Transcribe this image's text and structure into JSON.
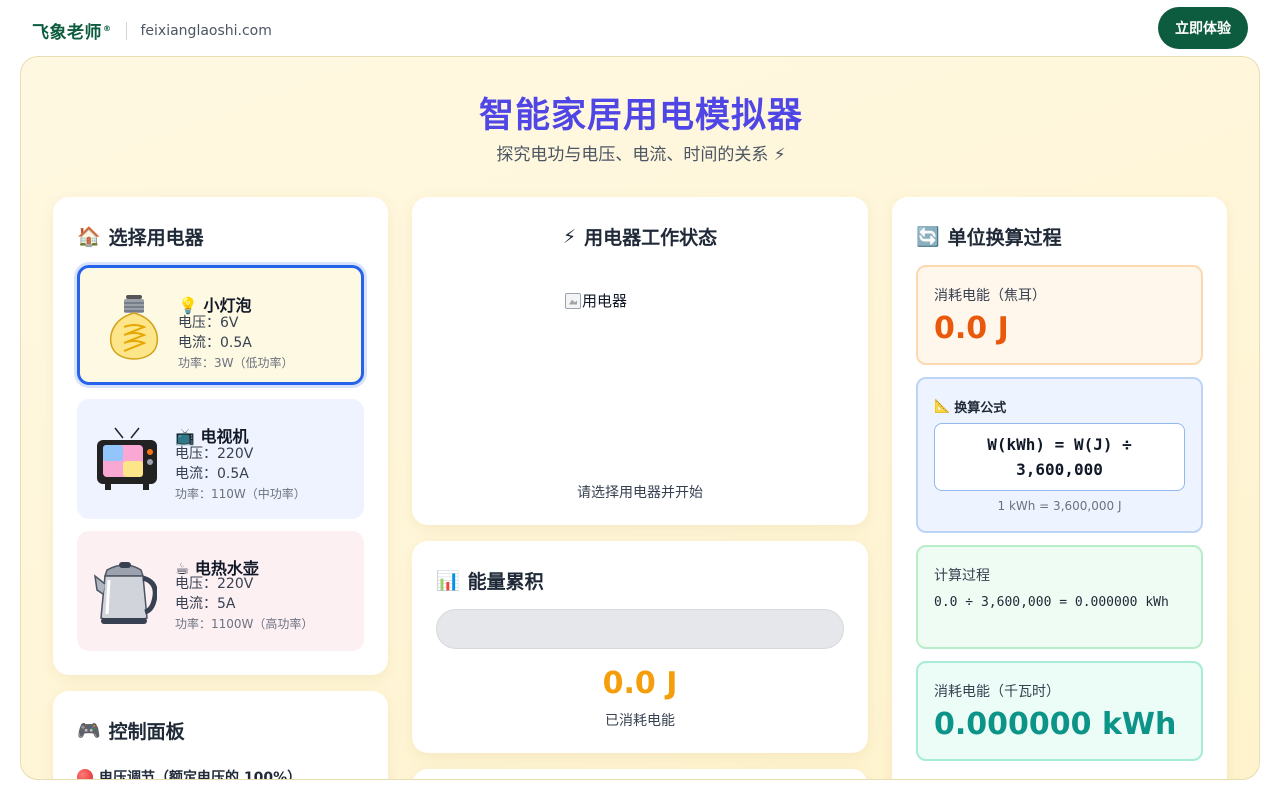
{
  "header": {
    "brand_name": "飞象老师",
    "brand_mark": "®",
    "brand_url": "feixianglaoshi.com",
    "cta_label": "立即体验"
  },
  "hero": {
    "title": "智能家居用电模拟器",
    "subtitle": "探究电功与电压、电流、时间的关系 ⚡"
  },
  "appliances_panel": {
    "title_icon": "🏠",
    "title": "选择用电器",
    "items": [
      {
        "icon": "💡",
        "name": "小灯泡",
        "voltage": "电压：6V",
        "current": "电流：0.5A",
        "power": "功率：3W（低功率）",
        "picture": "light-bulb",
        "selected": true,
        "bg": "#fef9e3"
      },
      {
        "icon": "📺",
        "name": "电视机",
        "voltage": "电压：220V",
        "current": "电流：0.5A",
        "power": "功率：110W（中功率）",
        "picture": "television",
        "selected": false,
        "bg": "#eef3ff"
      },
      {
        "icon": "☕",
        "name": "电热水壶",
        "voltage": "电压：220V",
        "current": "电流：5A",
        "power": "功率：1100W（高功率）",
        "picture": "kettle",
        "selected": false,
        "bg": "#fdf0f3"
      }
    ]
  },
  "control_panel": {
    "title_icon": "🎮",
    "title": "控制面板",
    "voltage_label": "电压调节（额定电压的 100%）"
  },
  "status_panel": {
    "title_icon": "⚡",
    "title": "用电器工作状态",
    "image_alt": "用电器",
    "status_text": "请选择用电器并开始"
  },
  "energy_panel": {
    "title_icon": "📊",
    "title": "能量累积",
    "progress": 0,
    "value": "0.0 J",
    "label": "已消耗电能"
  },
  "conversion_panel": {
    "title_icon": "🔄",
    "title": "单位换算过程",
    "joules_label": "消耗电能（焦耳）",
    "joules_value": "0.0 J",
    "formula_icon": "📐",
    "formula_label": "换算公式",
    "formula_line1": "W(kWh) = W(J) ÷",
    "formula_line2": "3,600,000",
    "formula_note": "1 kWh = 3,600,000 J",
    "calc_label": "计算过程",
    "calc_text": "0.0 ÷ 3,600,000 = 0.000000 kWh",
    "kwh_label": "消耗电能（千瓦时）",
    "kwh_value": "0.000000 kWh"
  },
  "colors": {
    "brand": "#0d5c3f",
    "title": "#4f46e5",
    "joules": "#ea580c",
    "energy": "#f59e0b",
    "kwh": "#0d9488",
    "selected_border": "#2563eb"
  }
}
